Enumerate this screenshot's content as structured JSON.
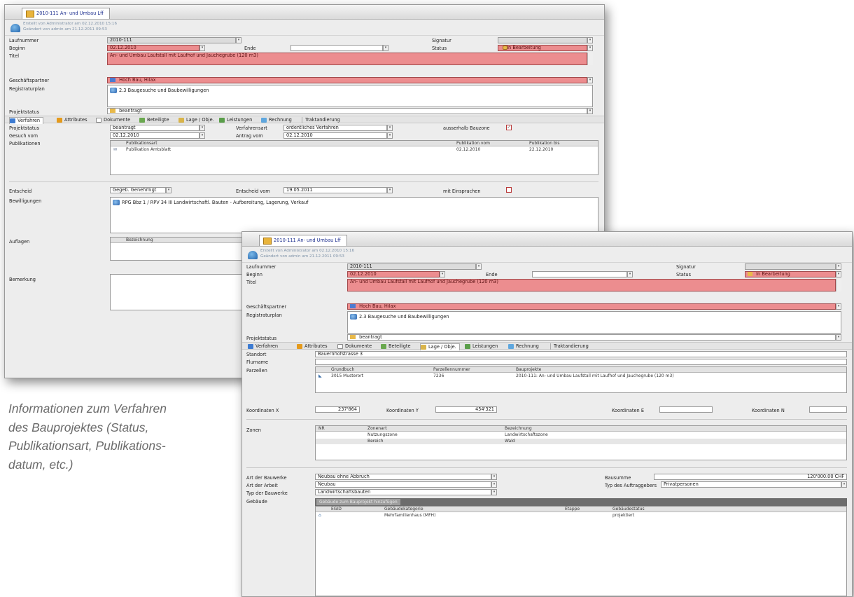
{
  "caption": [
    "Informationen zum Verfahren",
    "des Bauprojektes (Status,",
    "Publikationsart, Publikations-",
    "datum, etc.)"
  ],
  "window1": {
    "tab_title": "2010-111 An- und Umbau Lff",
    "info1": "Erstellt von Administrator am 02.12.2010 15:16",
    "info2": "Geändert von admin am 21.12.2011 09:53",
    "labels": {
      "laufnummer": "Laufnummer",
      "beginn": "Beginn",
      "ende": "Ende",
      "titel": "Titel",
      "signatur": "Signatur",
      "status": "Status",
      "geschaeftspartner": "Geschäftspartner",
      "registraturplan": "Registraturplan",
      "projektstatus": "Projektstatus"
    },
    "values": {
      "laufnummer": "2010-111",
      "beginn": "02.12.2010",
      "ende": "",
      "titel": "An- und Umbau Laufstall mit Laufhof und Jauchegrube (120 m3)",
      "signatur": "",
      "status": "In Bearbeitung",
      "geschaeftspartner": "Hoch Bau, Hilax",
      "registraturplan": "2.3 Baugesuche und Baubewilligungen",
      "projektstatus": "beantragt"
    },
    "tabs": [
      "Verfahren",
      "Attributes",
      "Dokumente",
      "Beteiligte",
      "Lage / Obje.",
      "Leistungen",
      "Rechnung",
      "Traktandierung"
    ],
    "verfahren": {
      "projektstatus_label": "Projektstatus",
      "projektstatus": "beantragt",
      "verfahrensart_label": "Verfahrensart",
      "verfahrensart": "ordentliches Verfahren",
      "ausserhalb_label": "ausserhalb Bauzone",
      "ausserhalb_checked": "✓",
      "gesuch_label": "Gesuch vom",
      "gesuch": "02.12.2010",
      "antrag_label": "Antrag vom",
      "antrag": "02.12.2010",
      "publikationen_label": "Publikationen",
      "pub_headers": [
        "Publikationsart",
        "Publikation vom",
        "Publikation bis"
      ],
      "pub_rows": [
        [
          "Publikation Amtsblatt",
          "02.12.2010",
          "22.12.2010"
        ]
      ],
      "entscheid_label": "Entscheid",
      "entscheid": "Gegeb. Genehmigt",
      "entscheid_vom_label": "Entscheid vom",
      "entscheid_vom": "19.05.2011",
      "einsprachen_label": "mit Einsprachen",
      "bewilligungen_label": "Bewilligungen",
      "bewilligung": "RPG Bbz 1 / RPV 34 III Landwirtschaftl. Bauten - Aufbereitung, Lagerung, Verkauf",
      "auflagen_label": "Auflagen",
      "auflagen_header": "Bezeichnung",
      "bemerkung_label": "Bemerkung"
    }
  },
  "window2": {
    "tab_title": "2010-111 An- und Umbau Lff",
    "info1": "Erstellt von Administrator am 02.12.2010 15:16",
    "info2": "Geändert von admin am 21.12.2011 09:53",
    "labels": {
      "laufnummer": "Laufnummer",
      "beginn": "Beginn",
      "ende": "Ende",
      "titel": "Titel",
      "signatur": "Signatur",
      "status": "Status",
      "geschaeftspartner": "Geschäftspartner",
      "registraturplan": "Registraturplan",
      "projektstatus": "Projektstatus"
    },
    "values": {
      "laufnummer": "2010-111",
      "beginn": "02.12.2010",
      "ende": "",
      "titel": "An- und Umbau Laufstall mit Laufhof und Jauchegrube (120 m3)",
      "signatur": "",
      "status": "In Bearbeitung",
      "geschaeftspartner": "Hoch Bau, Hilax",
      "registraturplan": "2.3 Baugesuche und Baubewilligungen",
      "projektstatus": "beantragt"
    },
    "tabs": [
      "Verfahren",
      "Attributes",
      "Dokumente",
      "Beteiligte",
      "Lage / Obje.",
      "Leistungen",
      "Rechnung",
      "Traktandierung"
    ],
    "lage": {
      "standort_label": "Standort",
      "standort": "Bauernhofstrasse 3",
      "flurname_label": "Flurname",
      "flurname": "",
      "parzellen_label": "Parzellen",
      "parz_headers": [
        "Grundbuch",
        "Parzellennummer",
        "Bauprojekte"
      ],
      "parz_rows": [
        [
          "3015 Musterort",
          "7236",
          "2010-111: An- und Umbau Laufstall mit Laufhof und Jauchegrube (120 m3)"
        ]
      ],
      "koordx_label": "Koordinaten X",
      "koordx": "237'864",
      "koordy_label": "Koordinaten Y",
      "koordy": "454'321",
      "koorde_label": "Koordinaten E",
      "koorde": "",
      "koordn_label": "Koordinaten N",
      "koordn": "",
      "zonen_label": "Zonen",
      "zonen_headers": [
        "NR",
        "Zonenart",
        "Bezeichnung"
      ],
      "zonen_rows": [
        [
          "",
          "Nutzungszone",
          "Landwirtschaftszone"
        ],
        [
          "",
          "Bereich",
          "Wald"
        ]
      ],
      "art_bauwerk_label": "Art der Bauwerke",
      "art_bauwerk": "Neubau ohne Abbruch",
      "art_arbeit_label": "Art der Arbeit",
      "art_arbeit": "Neubau",
      "typ_bauwerk_label": "Typ der Bauwerke",
      "typ_bauwerk": "Landwirtschaftsbauten",
      "bausumme_label": "Bausumme",
      "bausumme": "120'000.00 CHF",
      "typ_auftraggeber_label": "Typ des Auftraggebers",
      "typ_auftraggeber": "Privatpersonen",
      "gebaeude_label": "Gebäude",
      "gebaeude_button": "Gebäude zum Bauprojekt hinzufügen",
      "geb_headers": [
        "EGID",
        "Gebäudekategorie",
        "Etappe",
        "Gebäudestatus"
      ],
      "geb_rows": [
        [
          "",
          "Mehrfamilienhaus (MFH)",
          "",
          "projektiert"
        ]
      ]
    }
  }
}
